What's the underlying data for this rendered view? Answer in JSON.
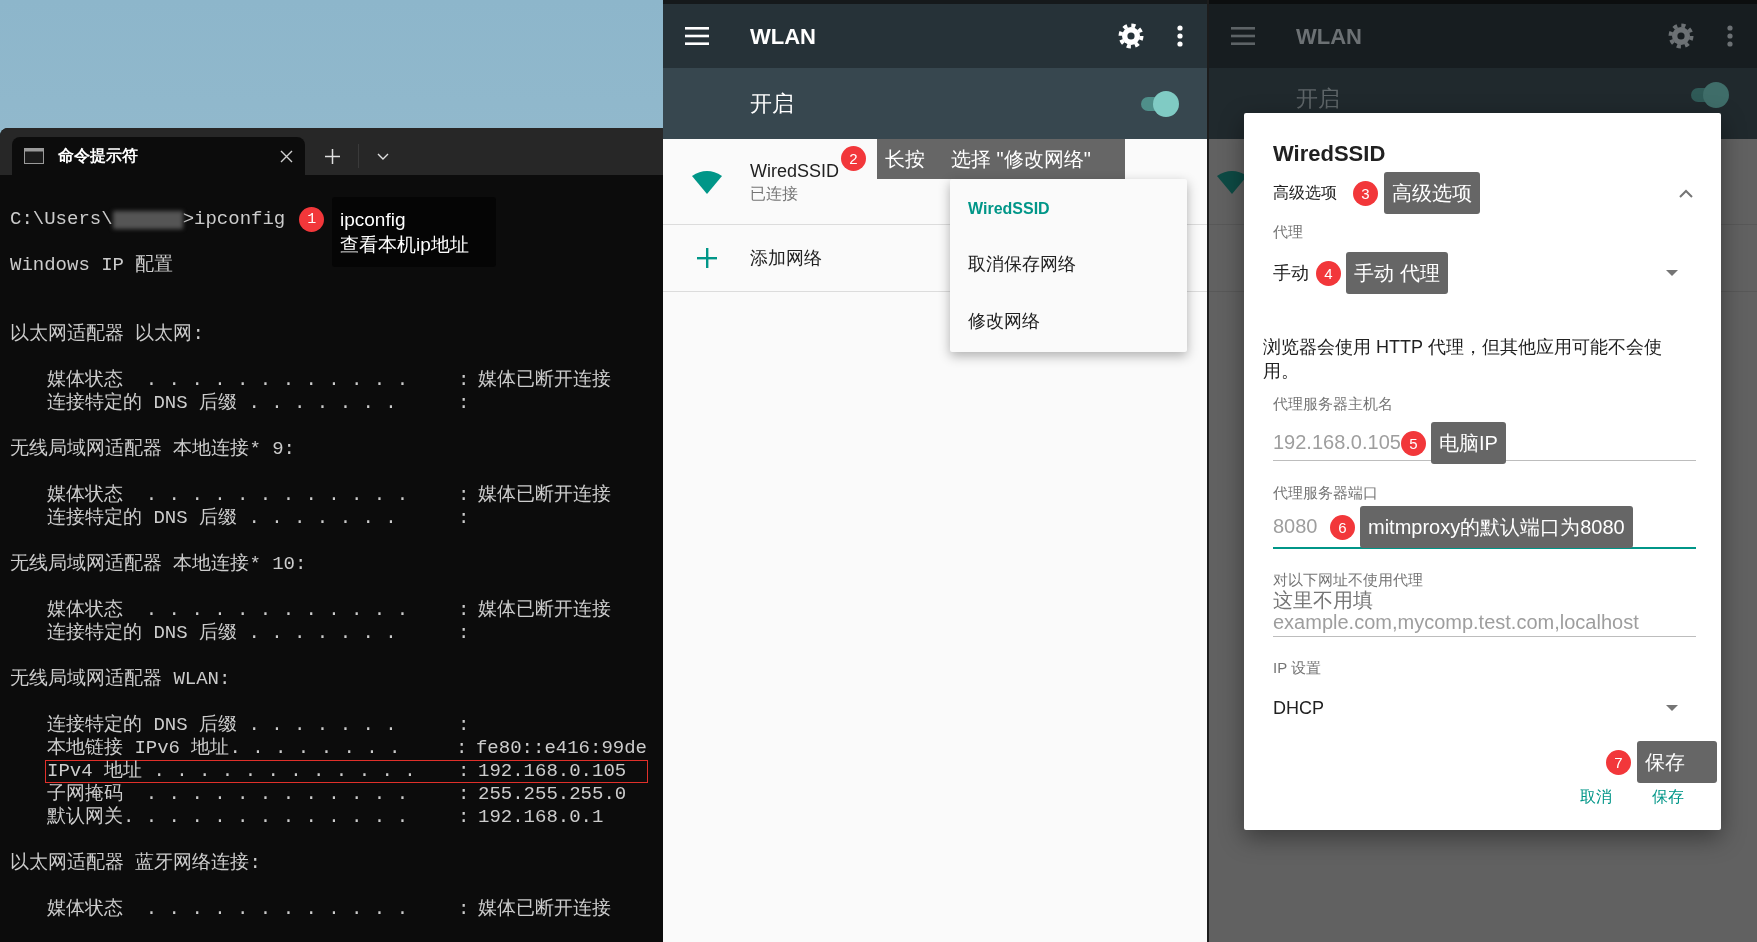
{
  "terminal": {
    "tab_title": "命令提示符",
    "prompt": {
      "prefix": "C:\\Users\\",
      "redacted": true,
      "command": ">ipconfig"
    },
    "annotation": {
      "number": "1",
      "texts": [
        "ipconfig",
        "查看本机ip地址"
      ]
    },
    "title_line": "Windows IP 配置",
    "sections": [
      {
        "heading": "以太网适配器 以太网:",
        "entries": [
          {
            "label": "媒体状态  . . . . . . . . . . . .",
            "separator": ":",
            "value": "媒体已断开连接",
            "highlighted": false
          },
          {
            "label": "连接特定的 DNS 后缀 . . . . . . .",
            "separator": ":",
            "highlighted": false
          }
        ]
      },
      {
        "heading": "无线局域网适配器 本地连接* 9:",
        "entries": [
          {
            "label": "媒体状态  . . . . . . . . . . . .",
            "separator": ":",
            "value": "媒体已断开连接",
            "highlighted": false
          },
          {
            "label": "连接特定的 DNS 后缀 . . . . . . .",
            "separator": ":",
            "highlighted": false
          }
        ]
      },
      {
        "heading": "无线局域网适配器 本地连接* 10:",
        "entries": [
          {
            "label": "媒体状态  . . . . . . . . . . . .",
            "separator": ":",
            "value": "媒体已断开连接",
            "highlighted": false
          },
          {
            "label": "连接特定的 DNS 后缀 . . . . . . .",
            "separator": ":",
            "highlighted": false
          }
        ]
      },
      {
        "heading": "无线局域网适配器 WLAN:",
        "entries": [
          {
            "label": "连接特定的 DNS 后缀 . . . . . . .",
            "separator": ":",
            "highlighted": false
          },
          {
            "label": "本地链接 IPv6 地址. . . . . . . .",
            "separator": ":",
            "value": "fe80::e416:99de",
            "highlighted": false
          },
          {
            "label": "IPv4 地址 . . . . . . . . . . . .",
            "separator": ":",
            "value": "192.168.0.105",
            "highlighted": true
          },
          {
            "label": "子网掩码  . . . . . . . . . . . .",
            "separator": ":",
            "value": "255.255.255.0",
            "highlighted": false
          },
          {
            "label": "默认网关. . . . . . . . . . . . .",
            "separator": ":",
            "value": "192.168.0.1",
            "highlighted": false
          }
        ]
      },
      {
        "heading": "以太网适配器 蓝牙网络连接:",
        "entries": [
          {
            "label": "媒体状态  . . . . . . . . . . . .",
            "separator": ":",
            "value": "媒体已断开连接",
            "highlighted": false
          }
        ]
      }
    ]
  },
  "wlan_screen": {
    "title": "WLAN",
    "master": {
      "label": "开启",
      "on": true
    },
    "networks": [
      {
        "name": "WiredSSID",
        "status": "已连接"
      }
    ],
    "add_network": "添加网络",
    "annotation": {
      "number": "2",
      "texts": [
        "长按",
        "选择 \"修改网络\""
      ]
    },
    "context_menu": {
      "title": "WiredSSID",
      "items": [
        "取消保存网络",
        "修改网络"
      ]
    }
  },
  "background_screen": {
    "title": "WLAN",
    "master": {
      "label": "开启",
      "on": true
    }
  },
  "dialog": {
    "title": "WiredSSID",
    "advanced": {
      "label": "高级选项",
      "expanded": true,
      "annotation": {
        "number": "3",
        "texts": [
          "高级选项"
        ]
      }
    },
    "proxy": {
      "label": "代理",
      "value": "手动",
      "annotation": {
        "number": "4",
        "texts": [
          "手动 代理"
        ]
      }
    },
    "note": "浏览器会使用 HTTP 代理，但其他应用可能不会使用。",
    "fields": [
      {
        "label": "代理服务器主机名",
        "placeholder": "192.168.0.105",
        "focused": false,
        "annotation": {
          "number": "5",
          "texts": [
            "电脑IP"
          ]
        }
      },
      {
        "label": "代理服务器端口",
        "placeholder": "8080",
        "focused": true,
        "annotation": {
          "number": "6",
          "texts": [
            "mitmproxy的默认端口为8080"
          ]
        }
      },
      {
        "label": "对以下网址不使用代理",
        "hint_note": "这里不用填",
        "placeholder": "example.com,mycomp.test.com,localhost",
        "focused": false
      }
    ],
    "ip_settings": {
      "label": "IP 设置",
      "value": "DHCP"
    },
    "save_annotation": {
      "number": "7",
      "texts": [
        "保存"
      ]
    },
    "buttons": [
      "取消",
      "保存"
    ]
  }
}
